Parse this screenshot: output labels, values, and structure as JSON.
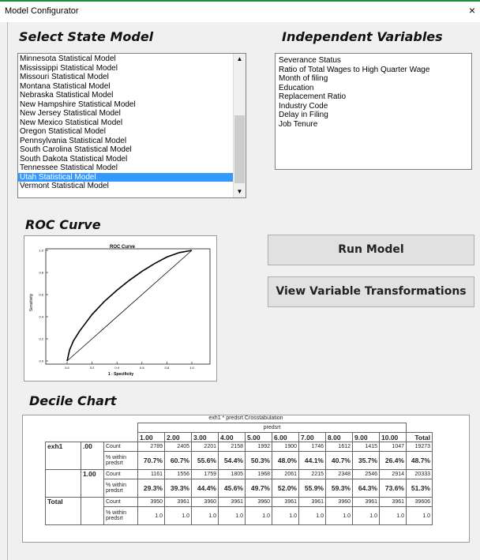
{
  "window": {
    "title": "Model Configurator",
    "close_glyph": "×"
  },
  "headings": {
    "select_state_model": "Select State Model",
    "independent_variables": "Independent Variables",
    "roc_curve": "ROC Curve",
    "decile_chart": "Decile Chart"
  },
  "state_models": [
    "Minnesota Statistical Model",
    "Mississippi Statistical Model",
    "Missouri Statistical Model",
    "Montana Statistical Model",
    "Nebraska Statistical Model",
    "New Hampshire Statistical Model",
    "New Jersey Statistical Model",
    "New Mexico Statistical Model",
    "Oregon Statistical Model",
    "Pennsylvania Statistical Model",
    "South Carolina Statistical Model",
    "South Dakota Statistical Model",
    "Tennessee Statistical Model",
    "Utah Statistical Model",
    "Vermont Statistical Model"
  ],
  "selected_state_model": "Utah Statistical Model",
  "independent_variables": [
    "Severance Status",
    "Ratio of Total Wages to High Quarter Wage",
    "Month of filing",
    "Education",
    "Replacement Ratio",
    "Industry Code",
    "Delay in Filing",
    "Job Tenure"
  ],
  "buttons": {
    "run_model": "Run Model",
    "view_transformations": "View Variable Transformations"
  },
  "roc_chart": {
    "title": "ROC Curve",
    "xlabel": "1 - Specificity",
    "ylabel": "Sensitivity",
    "ticks": [
      "0.0",
      "0.2",
      "0.4",
      "0.6",
      "0.8",
      "1.0"
    ]
  },
  "chart_data": {
    "type": "line",
    "title": "ROC Curve",
    "xlabel": "1 - Specificity",
    "ylabel": "Sensitivity",
    "xlim": [
      0,
      1
    ],
    "ylim": [
      0,
      1
    ],
    "series": [
      {
        "x": [
          0,
          0.02,
          0.05,
          0.1,
          0.2,
          0.3,
          0.4,
          0.5,
          0.6,
          0.7,
          0.8,
          0.9,
          1.0
        ],
        "y": [
          0,
          0.1,
          0.18,
          0.27,
          0.42,
          0.54,
          0.64,
          0.73,
          0.81,
          0.88,
          0.94,
          0.98,
          1.0
        ]
      },
      {
        "x": [
          0,
          1
        ],
        "y": [
          0,
          1
        ]
      }
    ]
  },
  "crosstab": {
    "title": "exh1 * predsrt Crosstabulation",
    "col_group": "predsrt",
    "columns": [
      "1.00",
      "2.00",
      "3.00",
      "4.00",
      "5.00",
      "6.00",
      "7.00",
      "8.00",
      "9.00",
      "10.00"
    ],
    "total_label": "Total",
    "row_var": "exh1",
    "count_label": "Count",
    "pct_label": "% within predsrt",
    "rows": [
      {
        "group": "exh1",
        "value": ".00",
        "counts": [
          "2789",
          "2405",
          "2201",
          "2158",
          "1992",
          "1900",
          "1746",
          "1612",
          "1415",
          "1047",
          "19273"
        ],
        "pcts": [
          "70.7%",
          "60.7%",
          "55.6%",
          "54.4%",
          "50.3%",
          "48.0%",
          "44.1%",
          "40.7%",
          "35.7%",
          "26.4%",
          "48.7%"
        ]
      },
      {
        "group": "",
        "value": "1.00",
        "counts": [
          "1161",
          "1556",
          "1759",
          "1805",
          "1968",
          "2061",
          "2215",
          "2348",
          "2546",
          "2914",
          "20333"
        ],
        "pcts": [
          "29.3%",
          "39.3%",
          "44.4%",
          "45.6%",
          "49.7%",
          "52.0%",
          "55.9%",
          "59.3%",
          "64.3%",
          "73.6%",
          "51.3%"
        ]
      },
      {
        "group": "Total",
        "value": "",
        "counts": [
          "3950",
          "3961",
          "3960",
          "3961",
          "3960",
          "3961",
          "3961",
          "3960",
          "3961",
          "3961",
          "39606"
        ],
        "pcts": [
          "1.0",
          "1.0",
          "1.0",
          "1.0",
          "1.0",
          "1.0",
          "1.0",
          "1.0",
          "1.0",
          "1.0",
          "1.0"
        ]
      }
    ]
  }
}
